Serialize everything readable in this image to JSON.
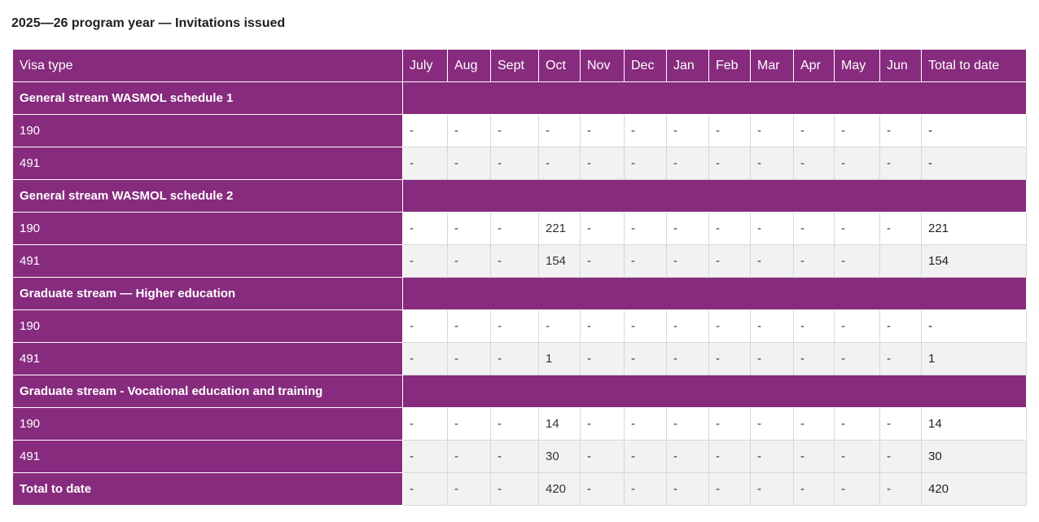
{
  "caption": "2025—26 program year — Invitations issued",
  "header": [
    "Visa type",
    "July",
    "Aug",
    "Sept",
    "Oct",
    "Nov",
    "Dec",
    "Jan",
    "Feb",
    "Mar",
    "Apr",
    "May",
    "Jun",
    "Total to date"
  ],
  "groups": [
    {
      "title": "General stream WASMOL schedule 1",
      "rows": [
        {
          "visa": "190",
          "values": [
            "-",
            "-",
            "-",
            "-",
            "-",
            "-",
            "-",
            "-",
            "-",
            "-",
            "-",
            "-",
            "-"
          ]
        },
        {
          "visa": "491",
          "values": [
            "-",
            "-",
            "-",
            "-",
            "-",
            "-",
            "-",
            "-",
            "-",
            "-",
            "-",
            "-",
            "-"
          ]
        }
      ]
    },
    {
      "title": "General stream WASMOL schedule 2",
      "rows": [
        {
          "visa": "190",
          "values": [
            "-",
            "-",
            "-",
            "221",
            "-",
            "-",
            "-",
            "-",
            "-",
            "-",
            "-",
            "-",
            "221"
          ]
        },
        {
          "visa": "491",
          "values": [
            "-",
            "-",
            "-",
            "154",
            "-",
            "-",
            "-",
            "-",
            "-",
            "-",
            "-",
            "",
            "154"
          ]
        }
      ]
    },
    {
      "title": "Graduate stream — Higher education",
      "rows": [
        {
          "visa": "190",
          "values": [
            "-",
            "-",
            "-",
            "-",
            "-",
            "-",
            "-",
            "-",
            "-",
            "-",
            "-",
            "-",
            "-"
          ]
        },
        {
          "visa": "491",
          "values": [
            "-",
            "-",
            "-",
            "1",
            "-",
            "-",
            "-",
            "-",
            "-",
            "-",
            "-",
            "-",
            "1"
          ]
        }
      ]
    },
    {
      "title": "Graduate stream - Vocational education and training",
      "rows": [
        {
          "visa": "190",
          "values": [
            "-",
            "-",
            "-",
            "14",
            "-",
            "-",
            "-",
            "-",
            "-",
            "-",
            "-",
            "-",
            "14"
          ]
        },
        {
          "visa": "491",
          "values": [
            "-",
            "-",
            "-",
            "30",
            "-",
            "-",
            "-",
            "-",
            "-",
            "-",
            "-",
            "-",
            "30"
          ]
        }
      ]
    }
  ],
  "total": {
    "label": "Total to date",
    "values": [
      "-",
      "-",
      "-",
      "420",
      "-",
      "-",
      "-",
      "-",
      "-",
      "-",
      "-",
      "-",
      "420"
    ]
  },
  "colors": {
    "header_bg": "#872b7e",
    "stripe": "#f2f2f2",
    "text_on_accent": "#ffffff"
  }
}
